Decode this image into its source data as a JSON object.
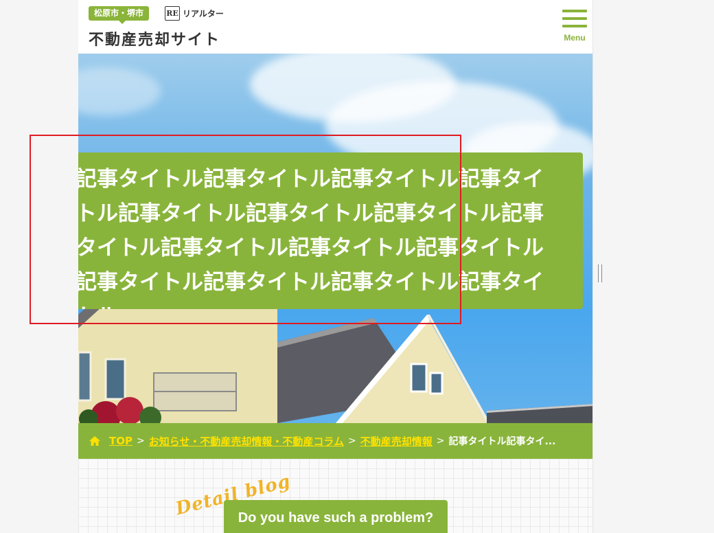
{
  "header": {
    "area_badge": "松原市・堺市",
    "logo_mark": "RE",
    "logo_text": "リアルター",
    "site_title": "不動産売却サイト",
    "menu_label": "Menu"
  },
  "hero": {
    "article_title": "記事タイトル記事タイトル記事タイトル記事タイトル記事タイトル記事タイトル記事タイトル記事タイトル記事タイトル記事タイトル記事タイトル記事タイトル記事タイトル記事タイトル記事タイトル"
  },
  "breadcrumb": {
    "items": [
      {
        "label": "TOP"
      },
      {
        "label": "お知らせ・不動産売却情報・不動産コラム"
      },
      {
        "label": "不動産売却情報"
      }
    ],
    "current": "記事タイトル記事タイ...",
    "separator": ">"
  },
  "content": {
    "script_label": "Detail blog",
    "problem_button": "Do you have such a problem?"
  },
  "colors": {
    "brand_green": "#89b43b",
    "link_yellow": "#ffe100",
    "script_orange": "#f0b428",
    "highlight_red": "#e01b22"
  },
  "icons": {
    "home": "home-icon",
    "menu": "hamburger-icon",
    "logo": "re-logo-icon"
  }
}
